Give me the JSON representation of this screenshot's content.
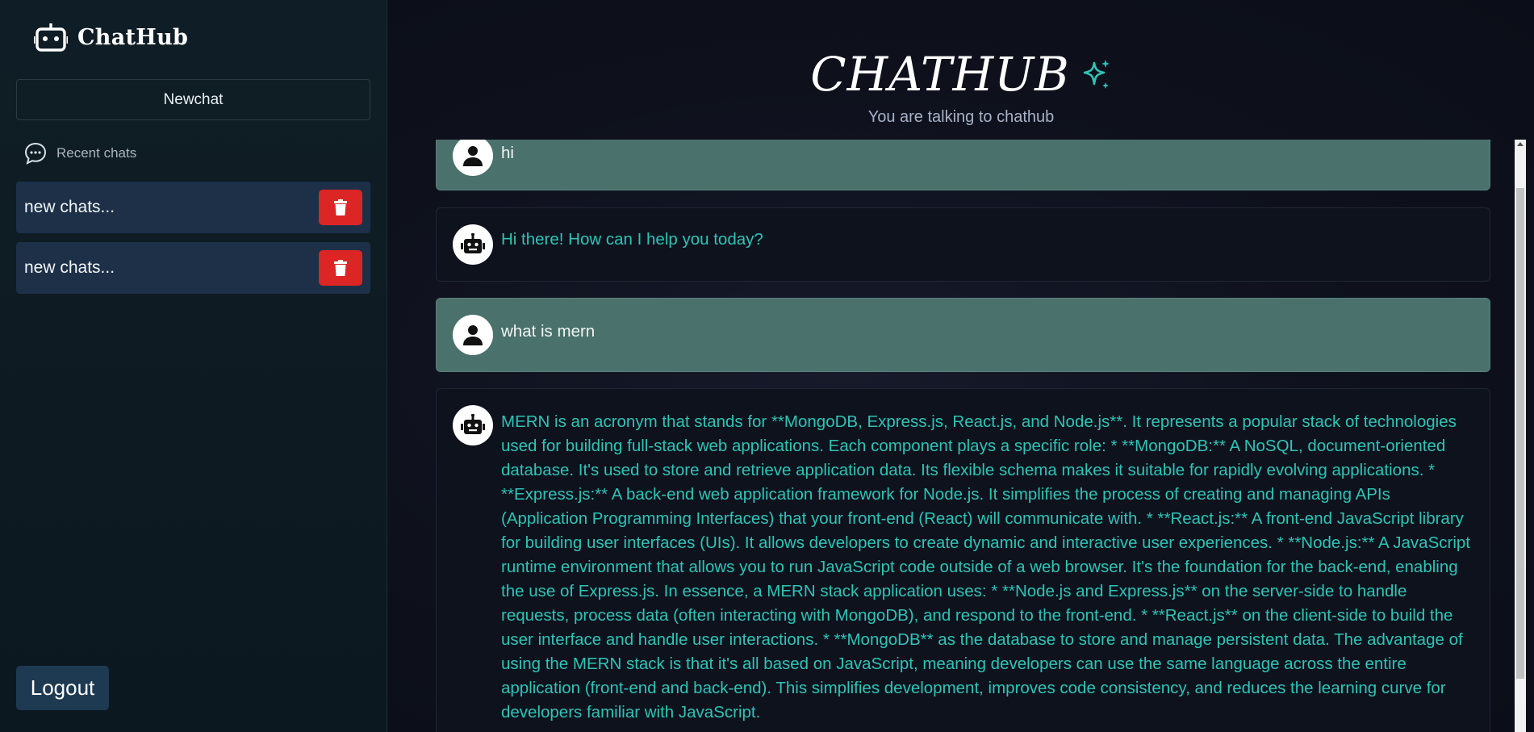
{
  "sidebar": {
    "brand": "ChatHub",
    "new_chat_label": "Newchat",
    "recent_label": "Recent chats",
    "items": [
      {
        "label": "new chats..."
      },
      {
        "label": "new chats..."
      }
    ],
    "logout_label": "Logout"
  },
  "main": {
    "title": "CHATHUB",
    "subtitle": "You are talking to chathub",
    "messages": [
      {
        "role": "user",
        "text": "hi"
      },
      {
        "role": "bot",
        "text": "Hi there! How can I help you today?"
      },
      {
        "role": "user",
        "text": "what is mern"
      },
      {
        "role": "bot",
        "text": "MERN is an acronym that stands for **MongoDB, Express.js, React.js, and Node.js**. It represents a popular stack of technologies used for building full-stack web applications. Each component plays a specific role: * **MongoDB:** A NoSQL, document-oriented database. It's used to store and retrieve application data. Its flexible schema makes it suitable for rapidly evolving applications. * **Express.js:** A back-end web application framework for Node.js. It simplifies the process of creating and managing APIs (Application Programming Interfaces) that your front-end (React) will communicate with. * **React.js:** A front-end JavaScript library for building user interfaces (UIs). It allows developers to create dynamic and interactive user experiences. * **Node.js:** A JavaScript runtime environment that allows you to run JavaScript code outside of a web browser. It's the foundation for the back-end, enabling the use of Express.js. In essence, a MERN stack application uses: * **Node.js and Express.js** on the server-side to handle requests, process data (often interacting with MongoDB), and respond to the front-end. * **React.js** on the client-side to build the user interface and handle user interactions. * **MongoDB** as the database to store and manage persistent data. The advantage of using the MERN stack is that it's all based on JavaScript, meaning developers can use the same language across the entire application (front-end and back-end). This simplifies development, improves code consistency, and reduces the learning curve for developers familiar with JavaScript."
      }
    ]
  },
  "icons": {
    "brand": "robot-icon",
    "recent": "chat-bubble-icon",
    "delete": "trash-icon",
    "user_avatar": "user-icon",
    "bot_avatar": "robot-icon",
    "title_decoration": "sparkle-icon"
  },
  "colors": {
    "accent": "#2ec4b6",
    "delete": "#dc2626",
    "user_bubble": "#4a716c",
    "chat_item": "#1d3048"
  }
}
